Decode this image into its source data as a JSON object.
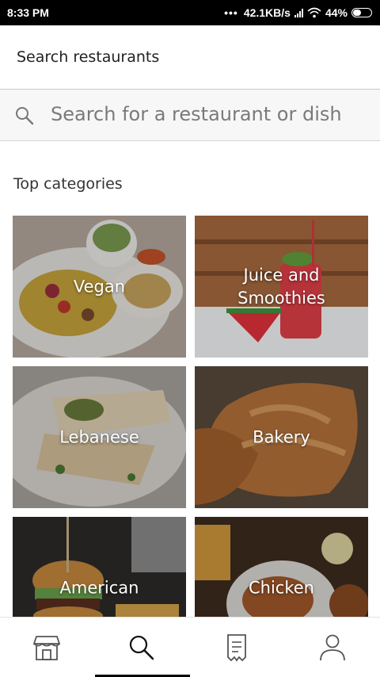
{
  "status_bar": {
    "time": "8:33 PM",
    "network": "42.1KB/s",
    "battery": "44%",
    "battery_level": 0.44,
    "icons": [
      "signal-icon",
      "wifi-icon",
      "battery-icon"
    ]
  },
  "header": {
    "title": "Search restaurants"
  },
  "search": {
    "placeholder": "Search for a restaurant or dish",
    "icon": "search-icon"
  },
  "section": {
    "title": "Top categories"
  },
  "categories": [
    {
      "label": "Vegan"
    },
    {
      "label": "Juice and\nSmoothies"
    },
    {
      "label": "Lebanese"
    },
    {
      "label": "Bakery"
    },
    {
      "label": "American"
    },
    {
      "label": "Chicken"
    }
  ],
  "bottom_nav": {
    "items": [
      "store-icon",
      "search-icon",
      "receipt-icon",
      "profile-icon"
    ],
    "active": "search-icon"
  },
  "colors": {
    "status_bar": "#000000",
    "search_background": "#f7f7f7",
    "text": "#222222"
  }
}
